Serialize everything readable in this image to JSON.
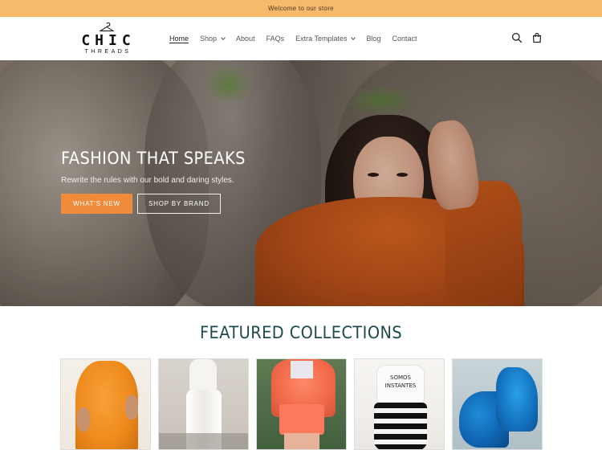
{
  "announcement": "Welcome to our store",
  "brand": {
    "name": "CHIC",
    "tagline": "THREADS"
  },
  "nav": {
    "items": [
      {
        "label": "Home",
        "active": true,
        "dropdown": false
      },
      {
        "label": "Shop",
        "active": false,
        "dropdown": true
      },
      {
        "label": "About",
        "active": false,
        "dropdown": false
      },
      {
        "label": "FAQs",
        "active": false,
        "dropdown": false
      },
      {
        "label": "Extra Templates",
        "active": false,
        "dropdown": true
      },
      {
        "label": "Blog",
        "active": false,
        "dropdown": false
      },
      {
        "label": "Contact",
        "active": false,
        "dropdown": false
      }
    ]
  },
  "hero": {
    "title": "FASHION THAT SPEAKS",
    "subtitle": "Rewrite the rules with our bold and daring styles.",
    "primary_button": "WHAT'S NEW",
    "secondary_button": "SHOP BY BRAND"
  },
  "featured": {
    "title": "FEATURED COLLECTIONS",
    "card4_print": "SOMOS INSTANTES"
  },
  "colors": {
    "announcement_bg": "#f7b96a",
    "accent": "#f08b3c",
    "heading": "#1e4a4a"
  },
  "icons": {
    "search": "search-icon",
    "cart": "cart-icon"
  }
}
